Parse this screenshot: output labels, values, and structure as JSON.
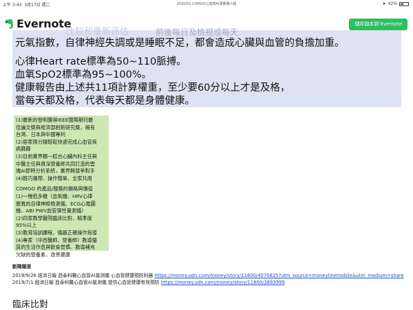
{
  "statusbar": {
    "time": "上午 3:43",
    "date": "3月17日 週二",
    "doc_title": "2020/02 COMGO心血管AI測量儀介紹",
    "battery": "42%",
    "battery_level": 0.42
  },
  "header": {
    "app_name": "Evernote",
    "save_button": "儲存副本到 Evernote"
  },
  "blue_box": {
    "ghost_top": "比较和重新评估",
    "ghost_mid": "前後每日及檢視或每天",
    "lines": [
      "元氣指數，自律神經失調或是睡眠不足，都會造成心臟與血管的負擔加重。",
      "心律Heart rate標準為50~110脈搏。",
      "血氧SpO2標準為95~100%。",
      "健康報告由上述共11項計算權重，至少要60分以上才是及格，",
      "當每天都及格，代表每天都是身體健康。"
    ]
  },
  "green_box": {
    "block1": [
      "(1)最新的發明獲得IEEE國際期刊最",
      "佳論文獎與經濟部創新研究獎，擁有",
      "台灣、日本與中國專利",
      "(2)居家兩分鐘輕鬆快速完成心血管疾",
      "病篩篩",
      "(3)目前業界獨一結合心臟內科主任與",
      "中醫主任與資深營養師共同打造的雲",
      "端AI即時分析系統，業界無競爭對手",
      "(4)輕巧攜帶、操作簡單、全家共用"
    ],
    "block2": [
      "COMGO 的產品/服務的價格與價值",
      "(1)一機抵多機（血氧機、HRV心律",
      "變異的自律神經檢測儀、ECG心電圖",
      "機、ABI PWV血管彈性量測儀）",
      "(2)四家教學醫院臨床比對，精準度",
      "95%以上",
      "(3)教育培訓課程，儀器正確操作指導",
      "(4)專家（中西醫師、營養師）教導優",
      "質的生活作息與飲食習慣、教導補充",
      "欠缺的營養素，改善健康"
    ]
  },
  "news": {
    "label": "新聞報道",
    "items": [
      {
        "text": "2019/9/26 經濟日報 昌泰科醫心血管AI量測儀 心血管健康預防利器 ",
        "link": "https://money.udn.com/money/story/11800/4070825?utm_source=moneylinemobile&utm_medium=share"
      },
      {
        "text": "2019/7/1 經濟日報 昌泰科醫心血管AI量測儀 提供心血管健康有效預防 ",
        "link": "https://money.udn.com/money/story/11800/3893999"
      }
    ]
  },
  "clinical_heading": "臨床比對"
}
